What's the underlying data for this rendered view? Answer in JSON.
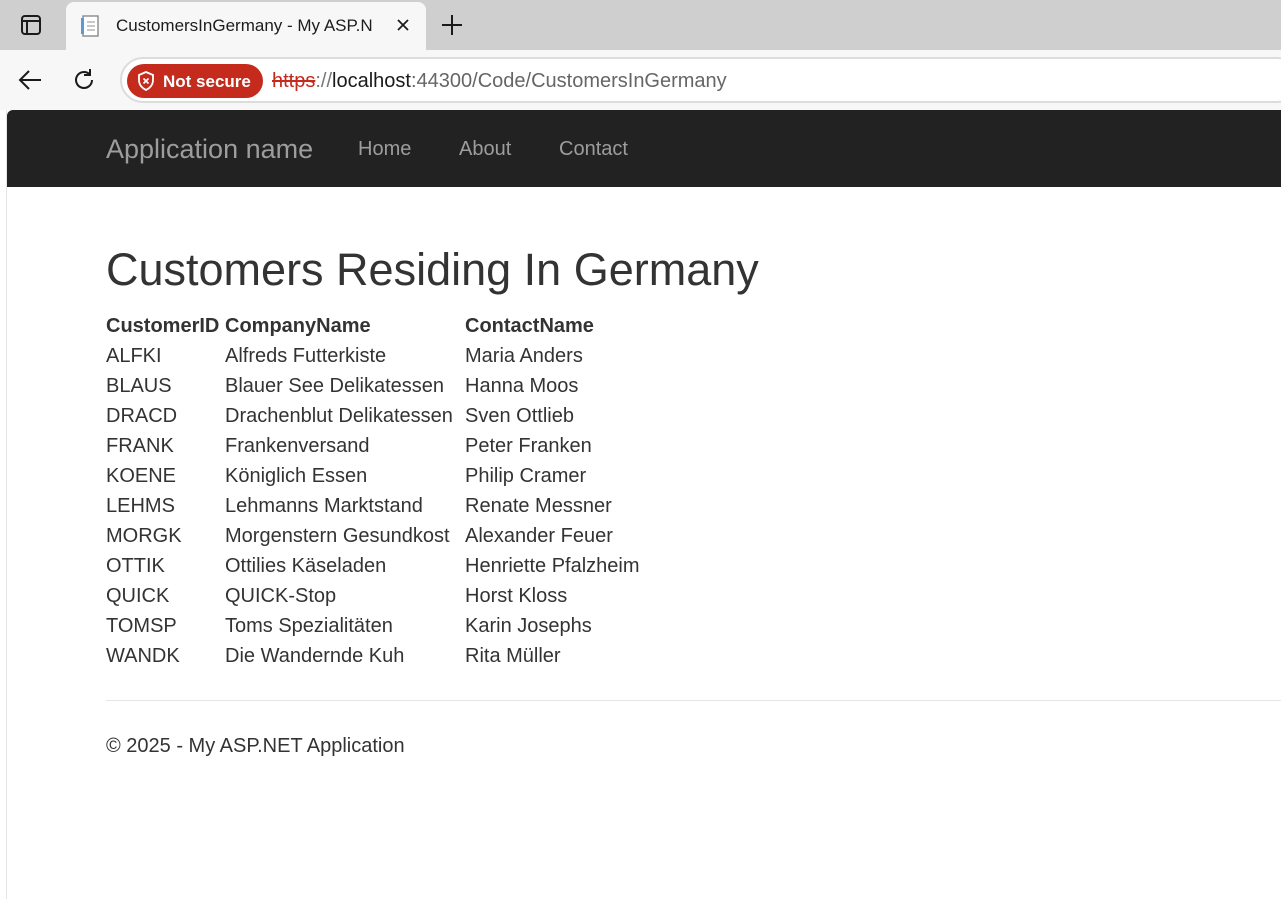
{
  "browser": {
    "tab": {
      "title": "CustomersInGermany - My ASP.N"
    },
    "security": {
      "label": "Not secure"
    },
    "url": {
      "scheme": "https",
      "separator": "://",
      "host": "localhost",
      "rest": ":44300/Code/CustomersInGermany"
    },
    "icons": {
      "tab_actions": "tab-actions-icon",
      "favicon": "document-icon",
      "close": "close-icon",
      "new_tab": "plus-icon",
      "back": "back-arrow-icon",
      "reload": "reload-icon",
      "security": "shield-icon"
    },
    "colors": {
      "not_secure": "#c42b1c",
      "navbar": "#222222",
      "nav_text": "#9d9d9d"
    }
  },
  "navbar": {
    "brand": "Application name",
    "links": [
      "Home",
      "About",
      "Contact"
    ]
  },
  "main": {
    "title": "Customers Residing In Germany",
    "table": {
      "headers": [
        "CustomerID",
        "CompanyName",
        "ContactName"
      ],
      "rows": [
        [
          "ALFKI",
          "Alfreds Futterkiste",
          "Maria Anders"
        ],
        [
          "BLAUS",
          "Blauer See Delikatessen",
          "Hanna Moos"
        ],
        [
          "DRACD",
          "Drachenblut Delikatessen",
          "Sven Ottlieb"
        ],
        [
          "FRANK",
          "Frankenversand",
          "Peter Franken"
        ],
        [
          "KOENE",
          "Königlich Essen",
          "Philip Cramer"
        ],
        [
          "LEHMS",
          "Lehmanns Marktstand",
          "Renate Messner"
        ],
        [
          "MORGK",
          "Morgenstern Gesundkost",
          "Alexander Feuer"
        ],
        [
          "OTTIK",
          "Ottilies Käseladen",
          "Henriette Pfalzheim"
        ],
        [
          "QUICK",
          "QUICK-Stop",
          "Horst Kloss"
        ],
        [
          "TOMSP",
          "Toms Spezialitäten",
          "Karin Josephs"
        ],
        [
          "WANDK",
          "Die Wandernde Kuh",
          "Rita Müller"
        ]
      ]
    }
  },
  "footer": {
    "text": "© 2025 - My ASP.NET Application"
  }
}
